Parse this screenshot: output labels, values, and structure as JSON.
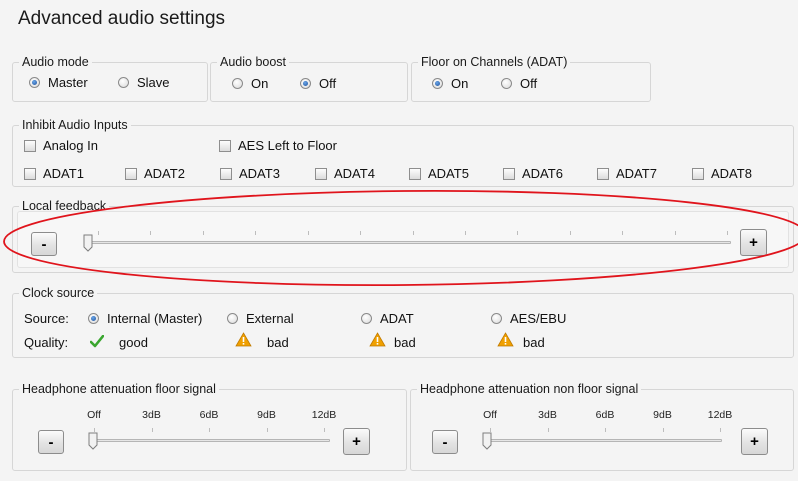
{
  "page": {
    "title": "Advanced audio settings"
  },
  "audio_mode": {
    "legend": "Audio mode",
    "options": [
      "Master",
      "Slave"
    ],
    "selected": "Master"
  },
  "audio_boost": {
    "legend": "Audio boost",
    "options": [
      "On",
      "Off"
    ],
    "selected": "Off"
  },
  "floor_channels": {
    "legend": "Floor on Channels (ADAT)",
    "options": [
      "On",
      "Off"
    ],
    "selected": "On"
  },
  "inhibit": {
    "legend": "Inhibit Audio Inputs",
    "analog_in": "Analog In",
    "aes_left": "AES Left to Floor",
    "adat": [
      "ADAT1",
      "ADAT2",
      "ADAT3",
      "ADAT4",
      "ADAT5",
      "ADAT6",
      "ADAT7",
      "ADAT8"
    ]
  },
  "local_feedback": {
    "legend": "Local feedback",
    "minus": "-",
    "plus": "+",
    "value_fraction": 0.0
  },
  "clock": {
    "legend": "Clock source",
    "source_label": "Source:",
    "quality_label": "Quality:",
    "sources": [
      "Internal (Master)",
      "External",
      "ADAT",
      "AES/EBU"
    ],
    "selected": "Internal (Master)",
    "qualities": [
      {
        "text": "good",
        "icon": "check-icon",
        "color": "#3aa62f"
      },
      {
        "text": "bad",
        "icon": "warning-icon",
        "color": "#f0a000"
      },
      {
        "text": "bad",
        "icon": "warning-icon",
        "color": "#f0a000"
      },
      {
        "text": "bad",
        "icon": "warning-icon",
        "color": "#f0a000"
      }
    ]
  },
  "hp_floor": {
    "legend": "Headphone attenuation floor signal",
    "ticks": [
      "Off",
      "3dB",
      "6dB",
      "9dB",
      "12dB"
    ],
    "minus": "-",
    "plus": "+",
    "value": "Off"
  },
  "hp_nonfloor": {
    "legend": "Headphone attenuation non floor signal",
    "ticks": [
      "Off",
      "3dB",
      "6dB",
      "9dB",
      "12dB"
    ],
    "minus": "-",
    "plus": "+",
    "value": "Off"
  },
  "annotation": {
    "color": "#e0141c"
  }
}
